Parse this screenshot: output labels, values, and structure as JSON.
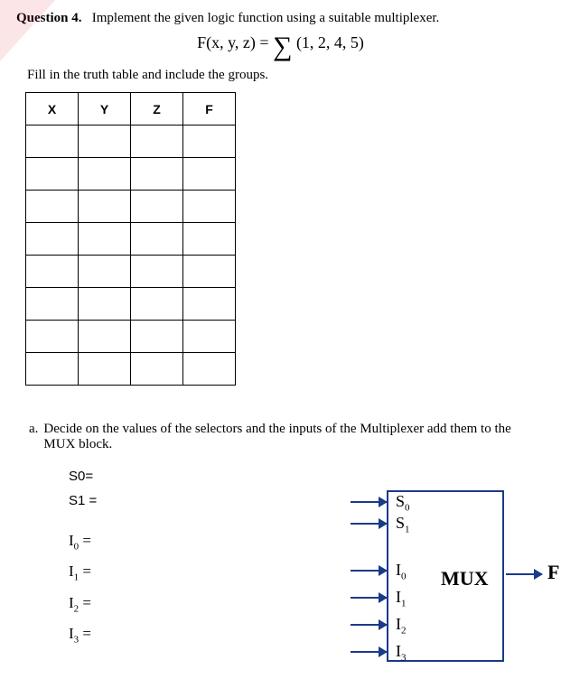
{
  "question": {
    "label": "Question 4.",
    "prompt": "Implement the given logic function using a suitable multiplexer.",
    "formula_lhs": "F(x, y, z) = ",
    "formula_terms": "(1, 2, 4, 5)",
    "instruction": "Fill in the truth table and include the groups."
  },
  "table": {
    "headers": [
      "X",
      "Y",
      "Z",
      "F"
    ],
    "rows": 8
  },
  "part_a": {
    "marker": "a.",
    "text": "Decide on the values of the selectors and the inputs of the Multiplexer add them to the MUX block."
  },
  "selectors": {
    "s0": "S0=",
    "s1": "S1 ="
  },
  "inputs": {
    "i0": "I",
    "i0_sub": "0",
    "i1": "I",
    "i1_sub": "1",
    "i2": "I",
    "i2_sub": "2",
    "i3": "I",
    "i3_sub": "3",
    "eq": "="
  },
  "mux": {
    "title": "MUX",
    "ports": {
      "s0": "S",
      "s0_sub": "0",
      "s1": "S",
      "s1_sub": "1",
      "i0": "I",
      "i0_sub": "0",
      "i1": "I",
      "i1_sub": "1",
      "i2": "I",
      "i2_sub": "2",
      "i3": "I",
      "i3_sub": "3"
    },
    "output": "F"
  }
}
